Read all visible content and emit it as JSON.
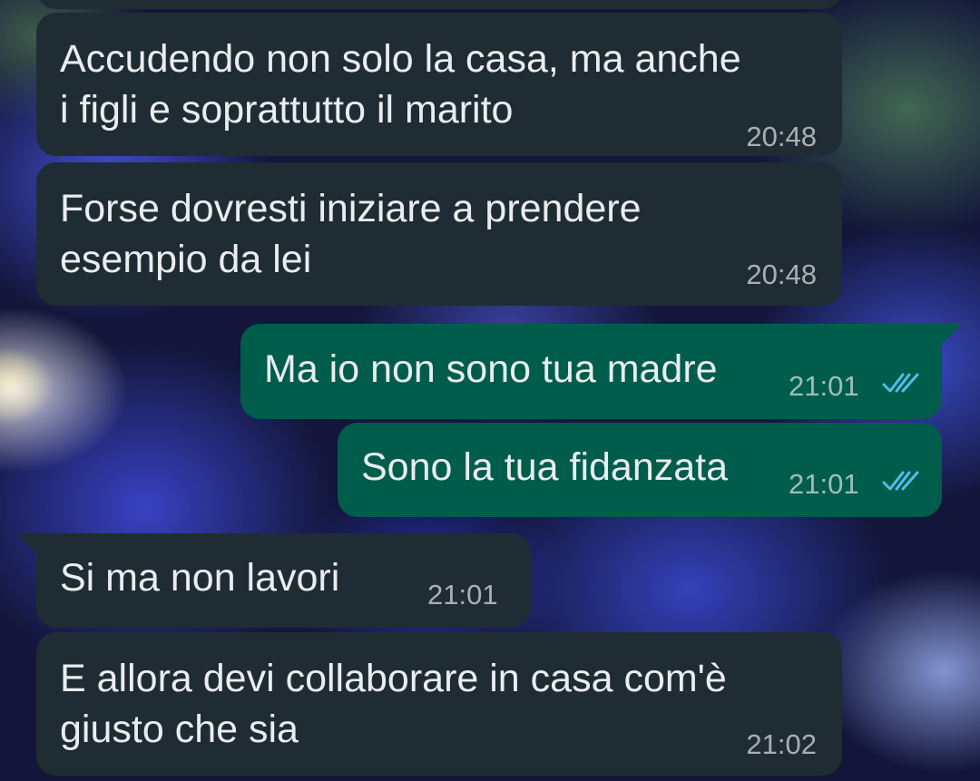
{
  "chat": {
    "messages": [
      {
        "direction": "incoming",
        "text_lines": [
          "Accudendo non solo la casa, ma anche",
          "i figli e soprattutto il marito"
        ],
        "time": "20:48"
      },
      {
        "direction": "incoming",
        "text_lines": [
          "Forse dovresti iniziare a prendere",
          "esempio da lei"
        ],
        "time": "20:48"
      },
      {
        "direction": "outgoing",
        "text_lines": [
          "Ma io non sono tua madre"
        ],
        "time": "21:01",
        "status": "read-double-check-icon"
      },
      {
        "direction": "outgoing",
        "text_lines": [
          "Sono la tua fidanzata"
        ],
        "time": "21:01",
        "status": "read-double-check-icon"
      },
      {
        "direction": "incoming",
        "text_lines": [
          "Si ma non lavori"
        ],
        "time": "21:01"
      },
      {
        "direction": "incoming",
        "text_lines": [
          "E allora devi collaborare in casa com'è",
          "giusto che sia"
        ],
        "time": "21:02"
      }
    ]
  },
  "colors": {
    "incoming_bubble": "#202c33",
    "outgoing_bubble": "#005c4b",
    "text": "#e9edef",
    "read_ticks": "#53bdeb"
  }
}
